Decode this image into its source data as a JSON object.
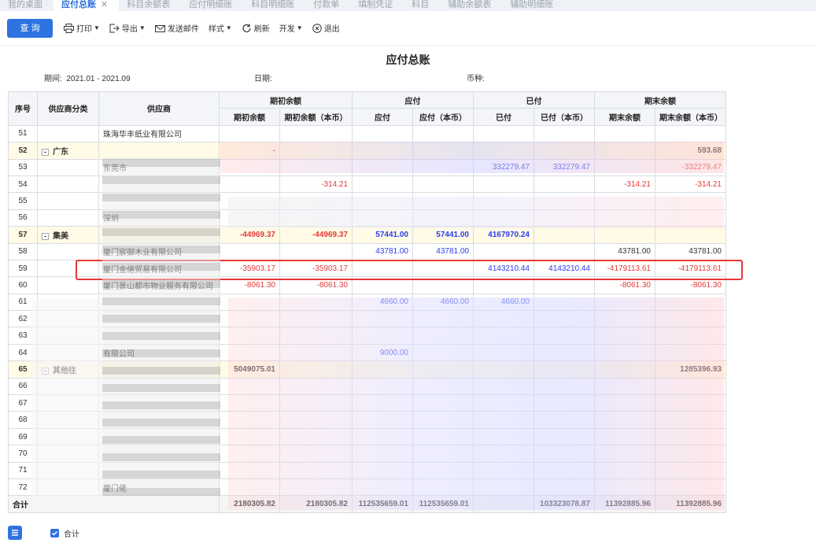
{
  "tabs": [
    {
      "label": "我的桌面",
      "close": ""
    },
    {
      "label": "应付总账",
      "close": "✕"
    },
    {
      "label": "科目余额表",
      "close": ""
    },
    {
      "label": "应付明细账",
      "close": ""
    },
    {
      "label": "科目明细账",
      "close": ""
    },
    {
      "label": "付款单",
      "close": ""
    },
    {
      "label": "填制凭证",
      "close": ""
    },
    {
      "label": "科目",
      "close": ""
    },
    {
      "label": "辅助余额表",
      "close": ""
    },
    {
      "label": "辅助明细账",
      "close": ""
    }
  ],
  "toolbar": {
    "query": "查 询",
    "print": "打印",
    "export": "导出",
    "send_mail": "发送邮件",
    "style": "样式",
    "refresh": "刷新",
    "dev": "开发",
    "exit": "退出"
  },
  "report": {
    "title": "应付总账",
    "period_label": "期间:",
    "period_value": "2021.01 - 2021.09",
    "date_label": "日期:",
    "currency_label": "币种:"
  },
  "headers": {
    "seq": "序号",
    "category": "供应商分类",
    "supplier": "供应商",
    "opening": "期初余额",
    "payable": "应付",
    "paid": "已付",
    "closing": "期末余额",
    "sub": [
      "期初余额",
      "期初余额（本币）",
      "应付",
      "应付（本币）",
      "已付",
      "已付（本币）",
      "期末余额",
      "期末余额（本币）"
    ]
  },
  "rows": [
    {
      "seq": "51",
      "cat": "",
      "sup": "珠海华丰纸业有限公司",
      "v": [
        "",
        "",
        "",
        "",
        "",
        "",
        "",
        ""
      ]
    },
    {
      "seq": "52",
      "cat": "广东",
      "grp": true,
      "sup": "",
      "v": [
        "-",
        "",
        "",
        "",
        "",
        "",
        "",
        "593.68"
      ]
    },
    {
      "seq": "53",
      "cat": "",
      "sup": "东莞市",
      "v": [
        "",
        "",
        "",
        "",
        "332279.47",
        "332279.47",
        "",
        "-332279.47"
      ]
    },
    {
      "seq": "54",
      "cat": "",
      "sup": "",
      "v": [
        "",
        "-314.21",
        "",
        "",
        "",
        "",
        "-314.21",
        "-314.21"
      ]
    },
    {
      "seq": "55",
      "cat": "",
      "sup": "",
      "v": [
        "",
        "",
        "",
        "",
        "",
        "",
        "",
        ""
      ]
    },
    {
      "seq": "56",
      "cat": "",
      "sup": "深圳",
      "v": [
        "",
        "",
        "",
        "",
        "",
        "",
        "",
        ""
      ]
    },
    {
      "seq": "57",
      "cat": "集美",
      "grp": true,
      "sup": "",
      "v": [
        "-44969.37",
        "-44969.37",
        "57441.00",
        "57441.00",
        "4167970.24",
        "",
        "",
        ""
      ]
    },
    {
      "seq": "58",
      "cat": "",
      "sup": "厦门宸御木业有限公司",
      "v": [
        "",
        "",
        "43781.00",
        "43781.00",
        "",
        "",
        "43781.00",
        "43781.00"
      ]
    },
    {
      "seq": "59",
      "cat": "",
      "sup": "厦门金億贸易有限公司",
      "v": [
        "-35903.17",
        "-35903.17",
        "",
        "",
        "4143210.44",
        "4143210.44",
        "-4179113.61",
        "-4179113.61"
      ]
    },
    {
      "seq": "60",
      "cat": "",
      "sup": "厦门景山都市物业服务有限公司",
      "v": [
        "-8061.30",
        "-8061.30",
        "",
        "",
        "",
        "",
        "-8061.30",
        "-8061.30"
      ]
    },
    {
      "seq": "61",
      "cat": "",
      "sup": "",
      "v": [
        "",
        "",
        "4660.00",
        "4660.00",
        "4660.00",
        "",
        "",
        ""
      ]
    },
    {
      "seq": "62",
      "cat": "",
      "sup": "",
      "v": [
        "",
        "",
        "",
        "",
        "",
        "",
        "",
        ""
      ]
    },
    {
      "seq": "63",
      "cat": "",
      "sup": "",
      "v": [
        "",
        "",
        "",
        "",
        "",
        "",
        "",
        ""
      ]
    },
    {
      "seq": "64",
      "cat": "",
      "sup": "有限公司",
      "v": [
        "",
        "",
        "9000.00",
        "",
        "",
        "",
        "",
        ""
      ]
    },
    {
      "seq": "65",
      "cat": "其他往",
      "grp": true,
      "sup": "",
      "v": [
        "5049075.01",
        "",
        "",
        "",
        "",
        "",
        "",
        "1285396.93"
      ]
    },
    {
      "seq": "66",
      "cat": "",
      "sup": "",
      "v": [
        "",
        "",
        "",
        "",
        "",
        "",
        "",
        ""
      ]
    },
    {
      "seq": "67",
      "cat": "",
      "sup": "",
      "v": [
        "",
        "",
        "",
        "",
        "",
        "",
        "",
        ""
      ]
    },
    {
      "seq": "68",
      "cat": "",
      "sup": "",
      "v": [
        "",
        "",
        "",
        "",
        "",
        "",
        "",
        ""
      ]
    },
    {
      "seq": "69",
      "cat": "",
      "sup": "",
      "v": [
        "",
        "",
        "",
        "",
        "",
        "",
        "",
        ""
      ]
    },
    {
      "seq": "70",
      "cat": "",
      "sup": "",
      "v": [
        "",
        "",
        "",
        "",
        "",
        "",
        "",
        ""
      ]
    },
    {
      "seq": "71",
      "cat": "",
      "sup": "",
      "v": [
        "",
        "",
        "",
        "",
        "",
        "",
        "",
        ""
      ]
    },
    {
      "seq": "72",
      "cat": "",
      "sup": "厦门佬",
      "v": [
        "",
        "",
        "",
        "",
        "",
        "",
        "",
        ""
      ]
    }
  ],
  "total": {
    "label": "合计",
    "v": [
      "2180305.82",
      "2180305.82",
      "112535659.01",
      "112535659.01",
      "",
      "103323078.87",
      "11392885.96",
      "11392885.96"
    ]
  },
  "footer": {
    "checkbox_label": "合计"
  },
  "colors": {
    "accent": "#2f73e0",
    "negative": "#e23b3b",
    "positive": "#2d3cf0",
    "highlight": "#e53935"
  }
}
